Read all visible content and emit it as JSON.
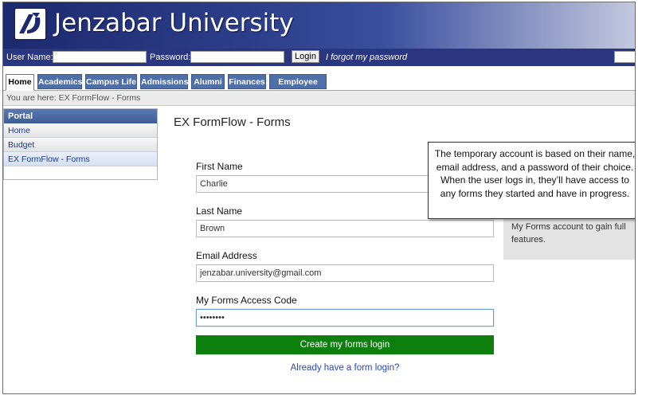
{
  "header": {
    "title": "Jenzabar University"
  },
  "loginbar": {
    "username_label": "User Name:",
    "password_label": "Password:",
    "login_button": "Login",
    "forgot_link": "I forgot my password"
  },
  "tabs": [
    {
      "label": "Home",
      "active": true
    },
    {
      "label": "Academics"
    },
    {
      "label": "Campus Life"
    },
    {
      "label": "Admissions"
    },
    {
      "label": "Alumni"
    },
    {
      "label": "Finances"
    },
    {
      "label": "Employee Info"
    }
  ],
  "breadcrumb": "You are here:  EX FormFlow - Forms",
  "portal": {
    "heading": "Portal",
    "items": [
      {
        "label": "Home"
      },
      {
        "label": "Budget"
      },
      {
        "label": "EX FormFlow - Forms",
        "active": true
      }
    ]
  },
  "main": {
    "title": "EX FormFlow - Forms",
    "fields": [
      {
        "label": "First Name",
        "value": "Charlie"
      },
      {
        "label": "Last Name",
        "value": "Brown"
      },
      {
        "label": "Email Address",
        "value": "jenzabar.university@gmail.com"
      },
      {
        "label": "My Forms Access Code",
        "value": "••••••••"
      }
    ],
    "submit_button": "Create my forms login",
    "already_link": "Already have a form login?"
  },
  "sidebox_text": "My Forms account to gain full features.",
  "callout_text": "The temporary account is based on their name, email address, and a password of their choice. When the user logs in, they’ll have access to any forms they started and have in progress.",
  "colors": {
    "header_blue": "#2a3680",
    "tab_blue": "#4f6fa8",
    "submit_green": "#0d7f0d",
    "link_blue": "#2749b8"
  }
}
